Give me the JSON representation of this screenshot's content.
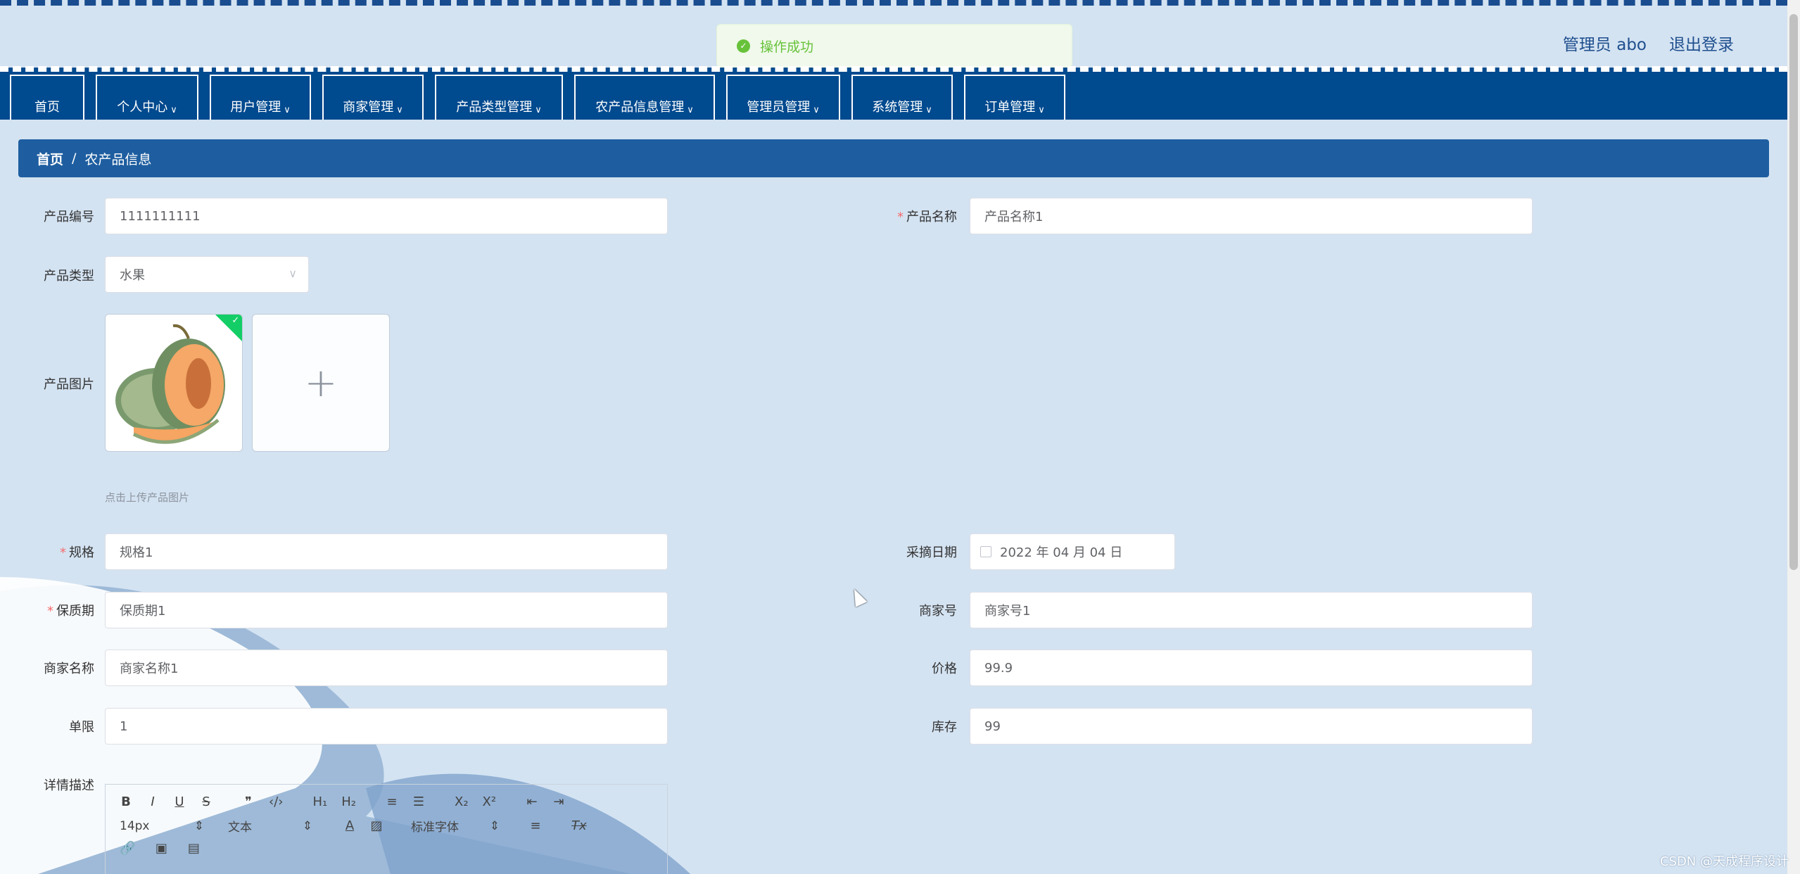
{
  "header": {
    "toast": "操作成功",
    "user_label": "管理员 abo",
    "logout_label": "退出登录"
  },
  "nav": {
    "items": [
      {
        "label": "首页"
      },
      {
        "label": "个人中心"
      },
      {
        "label": "用户管理"
      },
      {
        "label": "商家管理"
      },
      {
        "label": "产品类型管理"
      },
      {
        "label": "农产品信息管理"
      },
      {
        "label": "管理员管理"
      },
      {
        "label": "系统管理"
      },
      {
        "label": "订单管理"
      }
    ]
  },
  "breadcrumb": {
    "home": "首页",
    "separator": "/",
    "current": "农产品信息"
  },
  "form": {
    "product_code": {
      "label": "产品编号",
      "value": "1111111111"
    },
    "product_name": {
      "label": "产品名称",
      "value": "产品名称1",
      "required": "*"
    },
    "product_type": {
      "label": "产品类型",
      "value": "水果"
    },
    "product_image": {
      "label": "产品图片",
      "hint": "点击上传产品图片"
    },
    "spec": {
      "label": "规格",
      "value": "规格1",
      "required": "*"
    },
    "pick_date": {
      "label": "采摘日期",
      "value": "2022 年 04 月 04 日"
    },
    "shelf_life": {
      "label": "保质期",
      "value": "保质期1",
      "required": "*"
    },
    "merchant_no": {
      "label": "商家号",
      "value": "商家号1"
    },
    "merchant_name": {
      "label": "商家名称",
      "value": "商家名称1"
    },
    "price": {
      "label": "价格",
      "value": "99.9"
    },
    "limit": {
      "label": "单限",
      "value": "1"
    },
    "stock": {
      "label": "库存",
      "value": "99"
    },
    "description": {
      "label": "详情描述"
    }
  },
  "editor": {
    "row1": [
      "B",
      "I",
      "U",
      "S",
      "❞",
      "‹/›",
      "H₁",
      "H₂",
      "≡",
      "☰",
      "X₂",
      "X²",
      "⇤",
      "⇥"
    ],
    "font_size": "14px",
    "text_type": "文本",
    "font_family": "标准字体",
    "align": "≡",
    "clear": "Tx"
  },
  "watermark": "CSDN @天成程序设计"
}
